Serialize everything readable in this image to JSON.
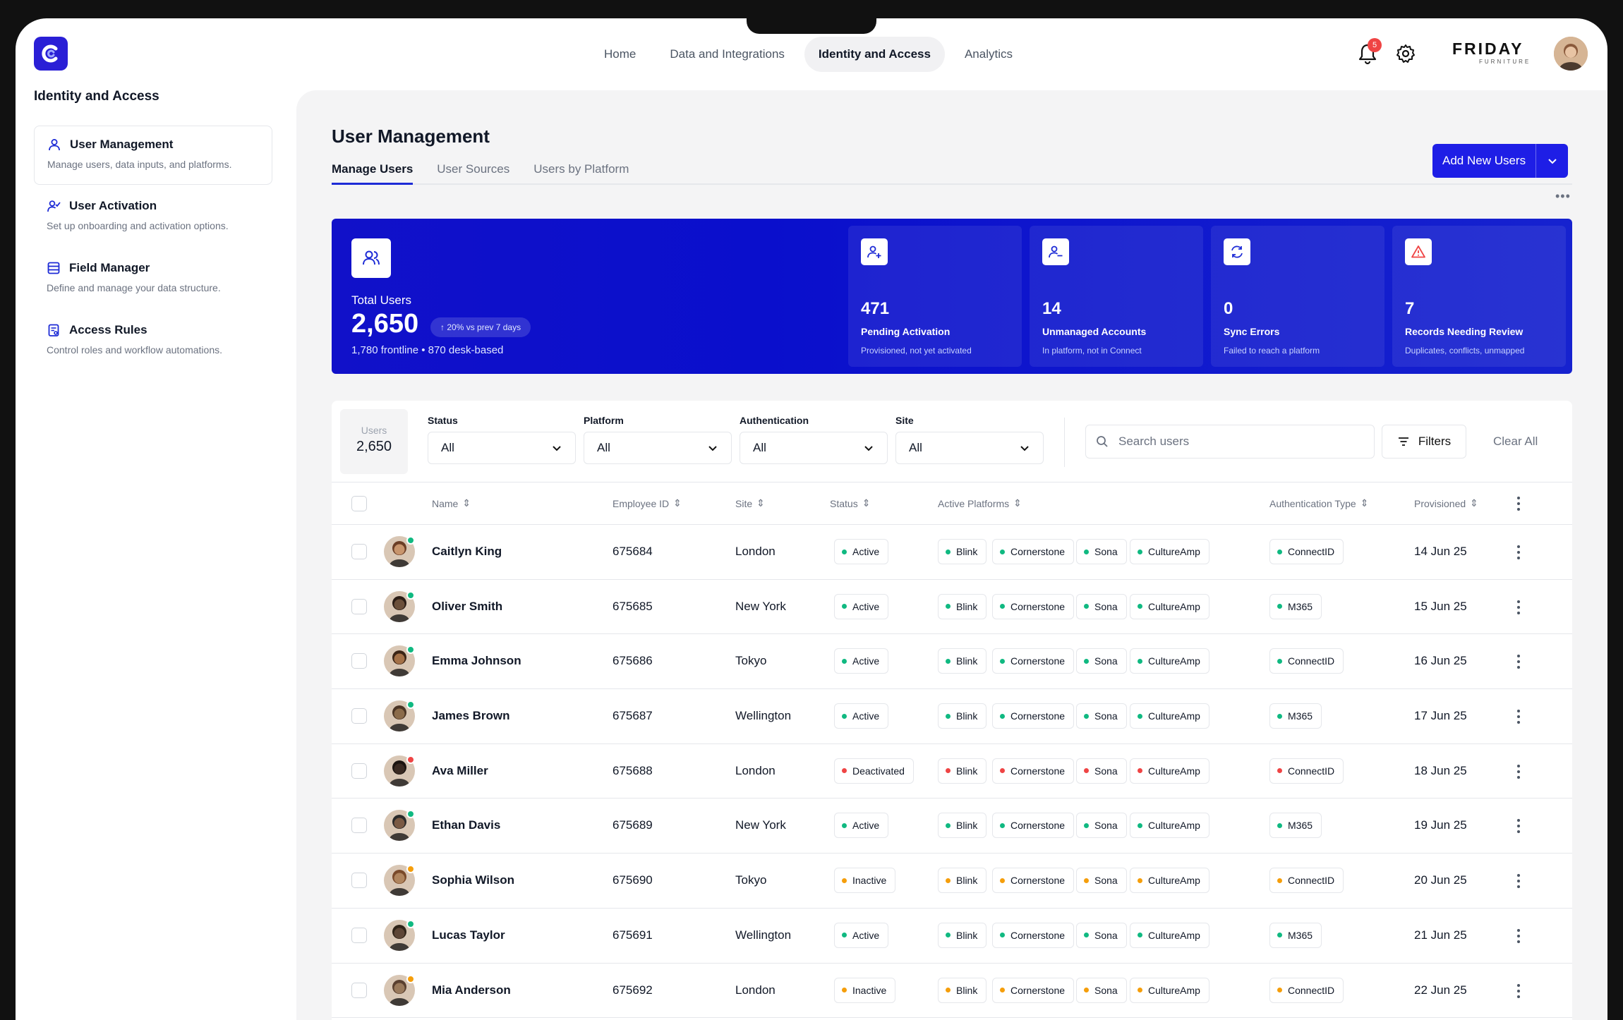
{
  "nav": {
    "items": [
      {
        "label": "Home",
        "active": false
      },
      {
        "label": "Data and Integrations",
        "active": false
      },
      {
        "label": "Identity and Access",
        "active": true
      },
      {
        "label": "Analytics",
        "active": false
      }
    ],
    "notification_count": "5",
    "brand_name": "FRIDAY",
    "brand_sub": "FURNITURE"
  },
  "sidebar": {
    "title": "Identity and Access",
    "items": [
      {
        "label": "User Management",
        "desc": "Manage users, data inputs, and platforms.",
        "icon": "user-icon"
      },
      {
        "label": "User Activation",
        "desc": "Set up onboarding and activation options.",
        "icon": "user-check-icon"
      },
      {
        "label": "Field Manager",
        "desc": "Define and manage your data structure.",
        "icon": "database-icon"
      },
      {
        "label": "Access Rules",
        "desc": "Control roles and workflow automations.",
        "icon": "clipboard-icon"
      }
    ]
  },
  "page": {
    "title": "User Management",
    "tabs": [
      "Manage Users",
      "User Sources",
      "Users by Platform"
    ],
    "add_button": "Add New Users"
  },
  "hero": {
    "label": "Total Users",
    "value": "2,650",
    "trend": "20% vs prev 7 days",
    "sub": "1,780 frontline • 870 desk-based",
    "stats": [
      {
        "value": "471",
        "label": "Pending Activation",
        "sub": "Provisioned, not yet activated",
        "icon": "user-plus-icon"
      },
      {
        "value": "14",
        "label": "Unmanaged Accounts",
        "sub": "In platform, not in Connect",
        "icon": "user-minus-icon"
      },
      {
        "value": "0",
        "label": "Sync Errors",
        "sub": "Failed to reach a platform",
        "icon": "refresh-icon"
      },
      {
        "value": "7",
        "label": "Records Needing Review",
        "sub": "Duplicates, conflicts, unmapped",
        "icon": "warning-icon"
      }
    ]
  },
  "filters": {
    "users_label": "Users",
    "users_count": "2,650",
    "selects": [
      {
        "label": "Status",
        "value": "All"
      },
      {
        "label": "Platform",
        "value": "All"
      },
      {
        "label": "Authentication",
        "value": "All"
      },
      {
        "label": "Site",
        "value": "All"
      }
    ],
    "search_placeholder": "Search users",
    "filters_label": "Filters",
    "clear_label": "Clear All"
  },
  "table": {
    "columns": [
      "Name",
      "Employee ID",
      "Site",
      "Status",
      "Active Platforms",
      "Authentication Type",
      "Provisioned"
    ],
    "status_colors": {
      "Active": "#10b981",
      "Deactivated": "#ef4444",
      "Inactive": "#f59e0b"
    },
    "rows": [
      {
        "name": "Caitlyn King",
        "id": "675684",
        "site": "London",
        "status": "Active",
        "platforms": [
          "Blink",
          "Cornerstone",
          "Sona",
          "CultureAmp"
        ],
        "auth": "ConnectID",
        "date": "14 Jun 25"
      },
      {
        "name": "Oliver Smith",
        "id": "675685",
        "site": "New York",
        "status": "Active",
        "platforms": [
          "Blink",
          "Cornerstone",
          "Sona",
          "CultureAmp"
        ],
        "auth": "M365",
        "date": "15 Jun 25"
      },
      {
        "name": "Emma Johnson",
        "id": "675686",
        "site": "Tokyo",
        "status": "Active",
        "platforms": [
          "Blink",
          "Cornerstone",
          "Sona",
          "CultureAmp"
        ],
        "auth": "ConnectID",
        "date": "16 Jun 25"
      },
      {
        "name": "James Brown",
        "id": "675687",
        "site": "Wellington",
        "status": "Active",
        "platforms": [
          "Blink",
          "Cornerstone",
          "Sona",
          "CultureAmp"
        ],
        "auth": "M365",
        "date": "17 Jun 25"
      },
      {
        "name": "Ava Miller",
        "id": "675688",
        "site": "London",
        "status": "Deactivated",
        "platforms": [
          "Blink",
          "Cornerstone",
          "Sona",
          "CultureAmp"
        ],
        "auth": "ConnectID",
        "date": "18 Jun 25"
      },
      {
        "name": "Ethan Davis",
        "id": "675689",
        "site": "New York",
        "status": "Active",
        "platforms": [
          "Blink",
          "Cornerstone",
          "Sona",
          "CultureAmp"
        ],
        "auth": "M365",
        "date": "19 Jun 25"
      },
      {
        "name": "Sophia Wilson",
        "id": "675690",
        "site": "Tokyo",
        "status": "Inactive",
        "platforms": [
          "Blink",
          "Cornerstone",
          "Sona",
          "CultureAmp"
        ],
        "auth": "ConnectID",
        "date": "20 Jun 25"
      },
      {
        "name": "Lucas Taylor",
        "id": "675691",
        "site": "Wellington",
        "status": "Active",
        "platforms": [
          "Blink",
          "Cornerstone",
          "Sona",
          "CultureAmp"
        ],
        "auth": "M365",
        "date": "21 Jun 25"
      },
      {
        "name": "Mia Anderson",
        "id": "675692",
        "site": "London",
        "status": "Inactive",
        "platforms": [
          "Blink",
          "Cornerstone",
          "Sona",
          "CultureAmp"
        ],
        "auth": "ConnectID",
        "date": "22 Jun 25"
      }
    ]
  }
}
